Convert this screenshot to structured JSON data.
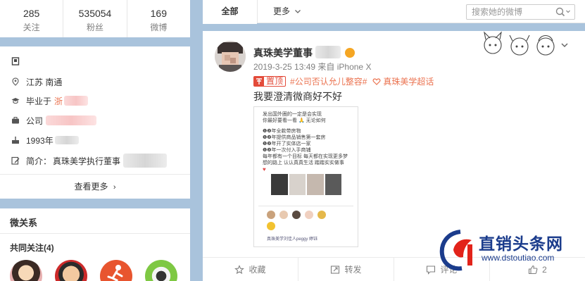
{
  "profile_counts": {
    "following": {
      "value": "285",
      "label": "关注"
    },
    "followers": {
      "value": "535054",
      "label": "粉丝"
    },
    "posts": {
      "value": "169",
      "label": "微博"
    }
  },
  "profile_info": {
    "location": "江苏 南通",
    "school_prefix": "毕业于",
    "school_partial": "浙",
    "company": "公司",
    "birthday": "1993年",
    "bio_prefix": "简介：",
    "bio": "真珠美学执行董事",
    "more_label": "查看更多"
  },
  "relations": {
    "title": "微关系",
    "mutual_label": "共同关注(4)"
  },
  "tabs": {
    "all": "全部",
    "more": "更多"
  },
  "search": {
    "placeholder": "搜索她的微博"
  },
  "post": {
    "author": "真珠美学董事",
    "meta": "2019-3-25 13:49 来自 iPhone X",
    "pinned_label": "置顶",
    "tags": [
      "#公司否认允儿整容#",
      "真珠美学超话"
    ],
    "text": "我要澄清微商好不好",
    "image_lines": [
      "发出国外圈的一定是会实现",
      "你最好要看一看 🙏 无论如何",
      "❶❷年全款带房物",
      "❶❷年提供商品销售第一套房",
      "❶❷年开了实体店一家",
      "❶❷年一次付入手商铺",
      "每年都有一个目标 每天都在实现更多梦",
      "想的路上 认认真真生活 踏踏实实做事"
    ],
    "image_comment_name": "真珠美学刘佳人peggy",
    "image_comment_tail": "婷钰"
  },
  "actions": {
    "favorite": "收藏",
    "repost": "转发",
    "comment": "评论",
    "like": "2"
  },
  "watermark": {
    "name": "直销头条网",
    "url": "www.dstoutiao.com",
    "overlay": "头条"
  },
  "colors": {
    "page_bg": "#a9c3dc",
    "accent": "#eb7350",
    "pin_red": "#e34b3a",
    "brand_blue": "#1b3c8c"
  }
}
